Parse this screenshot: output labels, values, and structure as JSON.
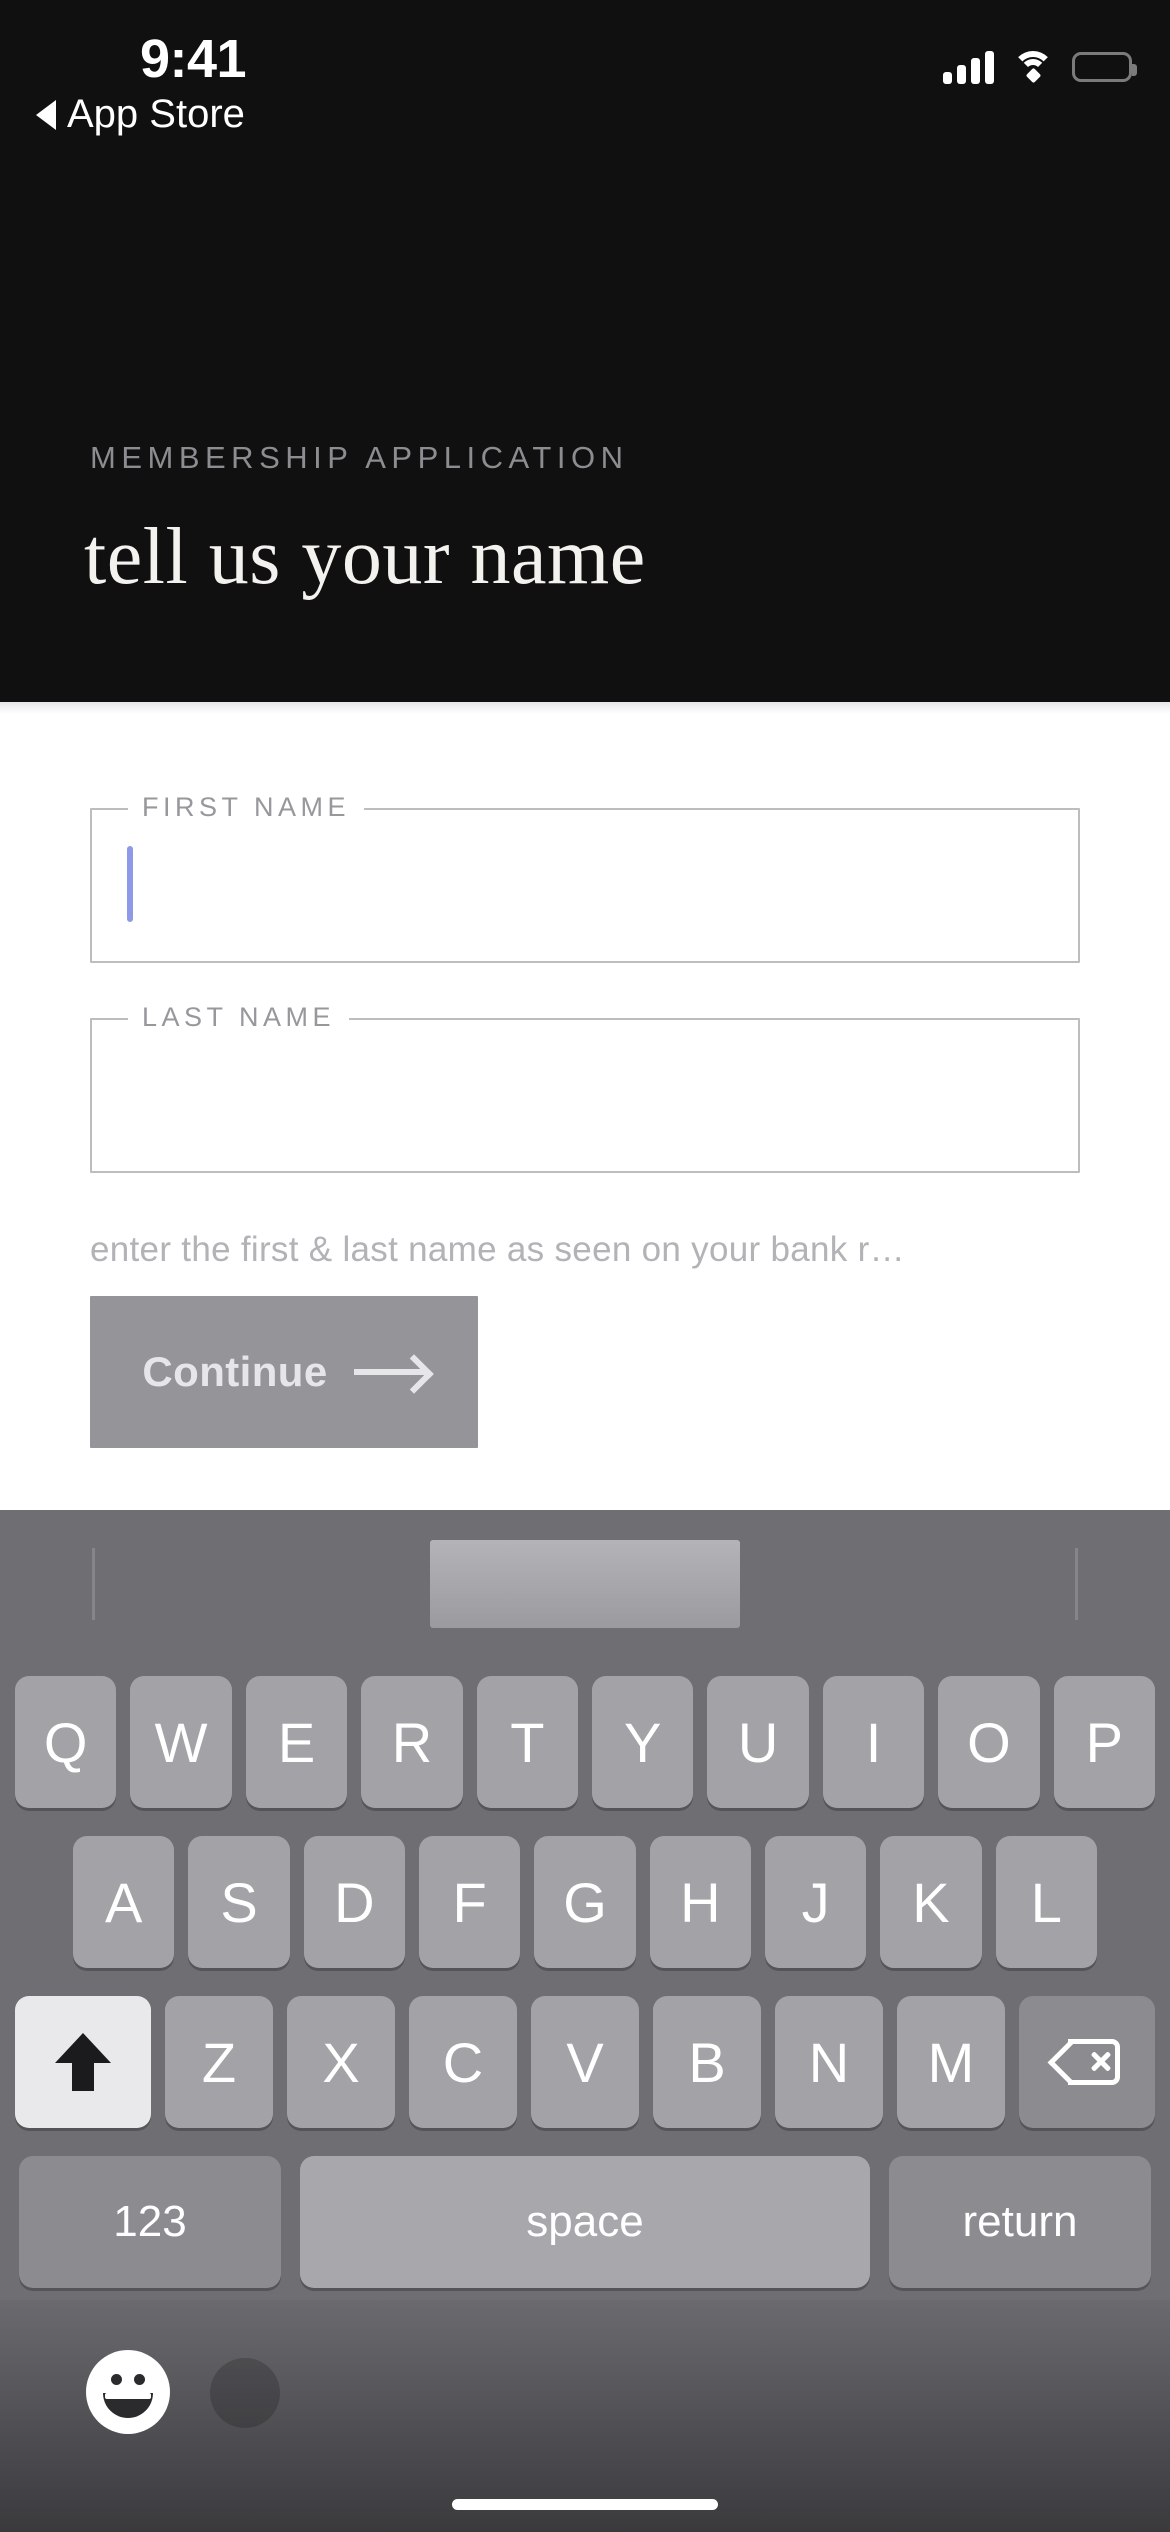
{
  "status_bar": {
    "time": "9:41",
    "back_label": "App Store",
    "signal_bars": 4,
    "wifi": "wifi-icon",
    "battery": "battery-full-icon"
  },
  "header": {
    "eyebrow": "MEMBERSHIP APPLICATION",
    "title": "tell us your name",
    "background_color": "#101011",
    "title_color": "#f4f2ef",
    "eyebrow_color": "#8c8c91"
  },
  "form": {
    "fields": [
      {
        "legend": "FIRST NAME",
        "value": "",
        "focused": true,
        "caret_color": "#8e9ae8"
      },
      {
        "legend": "LAST NAME",
        "value": "",
        "focused": false,
        "caret_color": "#8e9ae8"
      }
    ],
    "helper_text": "enter the first & last name as seen on your bank r…",
    "continue_label": "Continue",
    "continue_arrow": "arrow-right-icon",
    "continue_color": "#949499",
    "border_color": "#bdbdc0"
  },
  "keyboard": {
    "background_color": "#6e6e73",
    "key_color": "#a3a3a7",
    "function_key_color": "#8b8b90",
    "predictive_bar": {
      "suggestions": [
        "",
        "",
        ""
      ],
      "highlight_slot": 1
    },
    "row1": [
      "Q",
      "W",
      "E",
      "R",
      "T",
      "Y",
      "U",
      "I",
      "O",
      "P"
    ],
    "row2": [
      "A",
      "S",
      "D",
      "F",
      "G",
      "H",
      "J",
      "K",
      "L"
    ],
    "row3": [
      "Z",
      "X",
      "C",
      "V",
      "B",
      "N",
      "M"
    ],
    "shift_label": "shift-up-arrow-icon",
    "shift_active": true,
    "delete_label": "delete-backspace-icon",
    "numeric_label": "123",
    "space_label": "space",
    "return_label": "return",
    "emoji_label": "emoji-smiley-icon",
    "dictation_label": "microphone-icon"
  }
}
